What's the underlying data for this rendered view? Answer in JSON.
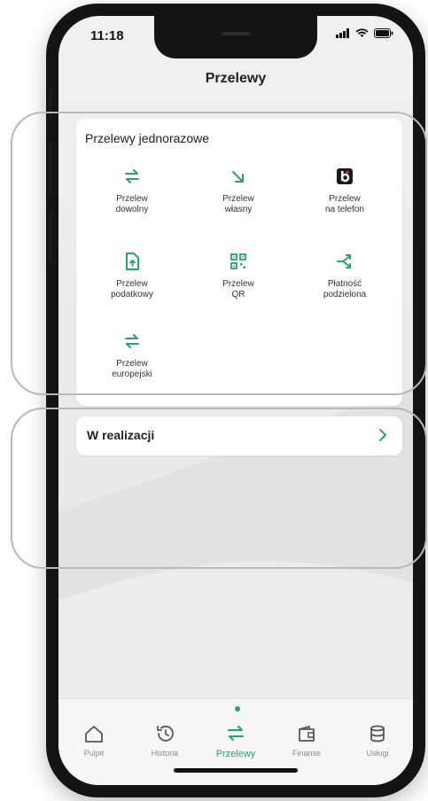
{
  "status": {
    "time": "11:18"
  },
  "header": {
    "title": "Przelewy"
  },
  "oneoff": {
    "title": "Przelewy jednorazowe",
    "tiles": [
      {
        "label": "Przelew\ndowolny",
        "icon": "transfer-arrows-icon"
      },
      {
        "label": "Przelew\nwłasny",
        "icon": "arrow-down-right-icon"
      },
      {
        "label": "Przelew\nna telefon",
        "icon": "blik-icon"
      },
      {
        "label": "Przelew\npodatkowy",
        "icon": "tax-document-icon"
      },
      {
        "label": "Przelew\nQR",
        "icon": "qr-code-icon"
      },
      {
        "label": "Płatność\npodzielona",
        "icon": "split-payment-icon"
      },
      {
        "label": "Przelew\neuropejski",
        "icon": "transfer-arrows-icon"
      }
    ]
  },
  "pending": {
    "label": "W realizacji"
  },
  "tabbar": {
    "items": [
      {
        "label": "Pulpit",
        "icon": "home-icon",
        "active": false
      },
      {
        "label": "Historia",
        "icon": "history-icon",
        "active": false
      },
      {
        "label": "Przelewy",
        "icon": "transfer-arrows-icon",
        "active": true
      },
      {
        "label": "Finanse",
        "icon": "finance-wallet-icon",
        "active": false
      },
      {
        "label": "Usługi",
        "icon": "database-icon",
        "active": false
      }
    ]
  },
  "colors": {
    "accent": "#2e9e6d",
    "text": "#222222",
    "inactive": "#8a8a8a"
  }
}
